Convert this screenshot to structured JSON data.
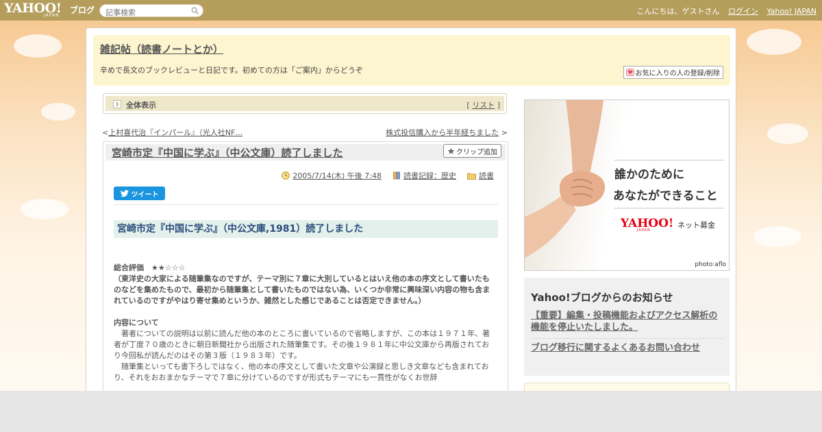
{
  "topbar": {
    "logo": "YAHOO!",
    "logo_sub": "JAPAN",
    "logo_blog": "ブログ",
    "search_placeholder": "記事検索",
    "greeting": "こんにちは、ゲストさん",
    "login": "ログイン",
    "yahoo_japan": "Yahoo! JAPAN"
  },
  "blog": {
    "title": "雑記帖（読書ノートとか）",
    "description": "辛めで長文のブックレビューと日記です。初めての方は「ご案内」からどうぞ",
    "favorite_button": "お気に入りの人の登録/削除"
  },
  "nav": {
    "all_view": "全体表示",
    "list_bracket_open": "[",
    "list_label": "リスト",
    "list_bracket_close": "]",
    "prev_arrow": "<",
    "prev_title": "上村喜代治『インパール』（光人社NF…",
    "next_title": "株式投信購入から半年経ちました",
    "next_arrow": ">"
  },
  "article": {
    "title": "宮崎市定『中国に学ぶ』（中公文庫）読了しました",
    "clip_button": "クリップ追加",
    "date": "2005/7/14(木) 午後 7:48",
    "category": "読書記録：歴史",
    "folder": "読書",
    "tweet": "ツイート",
    "subhead": "宮崎市定『中国に学ぶ』（中公文庫,1981）読了しました",
    "rating_label": "総合評価　★★☆☆☆",
    "rating_note": "（東洋史の大家による随筆集なのですが、テーマ別に７章に大別しているとはいえ他の本の序文として書いたものなどを集めたもので、最初から随筆集として書いたものではない為、いくつか非常に興味深い内容の物も含まれているのですがやはり寄せ集めというか、雑然とした感じであることは否定できません。）",
    "content_heading": "内容について",
    "content_p1": "　著者についての説明は以前に読んだ他の本のところに書いているので省略しますが、この本は１９７１年、著者が丁度７０歳のときに朝日新聞社から出版された随筆集です。その後１９８１年に中公文庫から再版されており今回私が読んだのはその第３版（１９８３年）です。",
    "content_p2": "　随筆集といっても書下ろしではなく、他の本の序文として書いた文章や公演録と思しき文章なども含まれており、それをおおまかなテーマで７章に分けているのですが形式もテーマにも一貫性がなくお世辞"
  },
  "sidebar": {
    "ad_line1": "誰かのために",
    "ad_line2": "あなたができること",
    "ad_logo": "YAHOO!",
    "ad_logo_sub": "JAPAN",
    "ad_service": "ネット募金",
    "ad_credit": "photo:aflo",
    "news_title": "Yahoo!ブログからのお知らせ",
    "news_items": [
      "【重要】編集・投稿機能およびアクセス解析の機能を停止いたしました。",
      "ブログ移行に関するよくあるお問い合わせ"
    ]
  },
  "colors": {
    "topbar": "#b59e5c",
    "header_bg": "#fdf5cf",
    "subhead_bg": "#e3f0ec",
    "subhead_text": "#2a4c7a",
    "tweet": "#1b95e0"
  }
}
